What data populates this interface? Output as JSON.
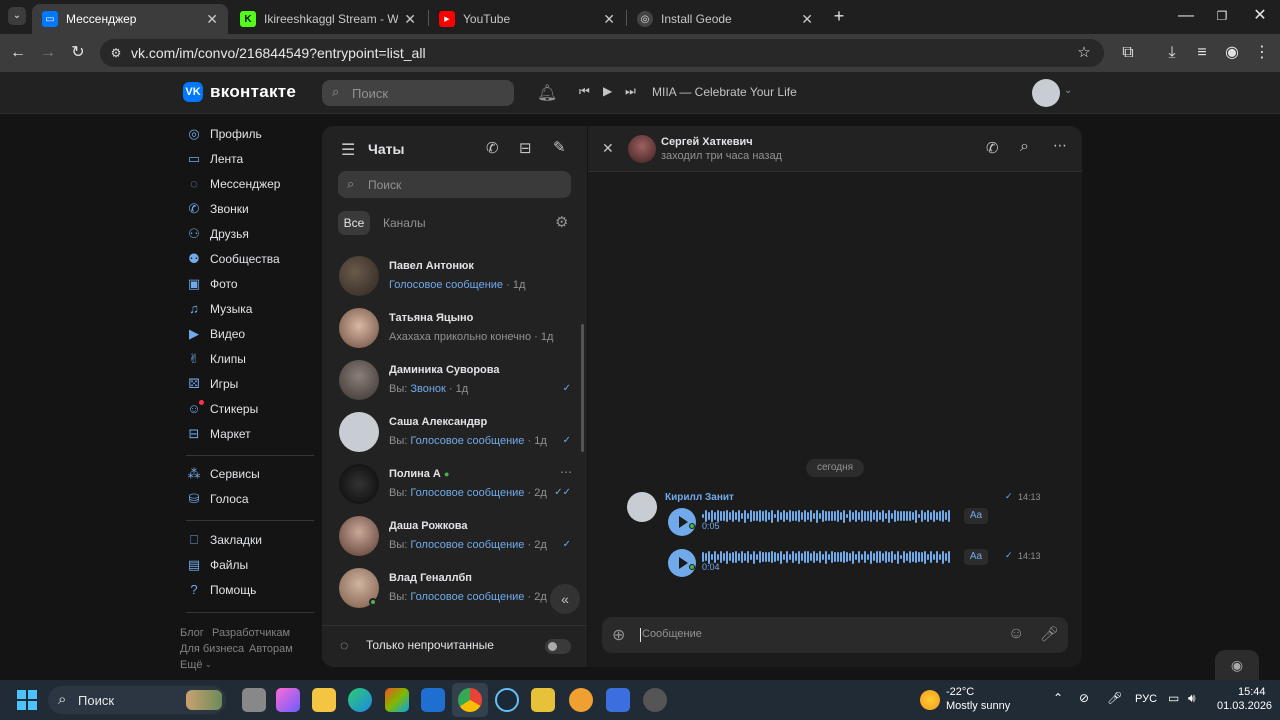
{
  "browser": {
    "tabs": [
      {
        "title": "Мессенджер",
        "active": true
      },
      {
        "title": "Ikireeshkaggl Stream - Watch L",
        "active": false
      },
      {
        "title": "YouTube",
        "active": false
      },
      {
        "title": "Install Geode",
        "active": false
      }
    ],
    "url": "vk.com/im/convo/216844549?entrypoint=list_all"
  },
  "vk": {
    "brand": "вконтакте",
    "search_placeholder": "Поиск",
    "player_track": "MIIA — Celebrate Your Life"
  },
  "nav": {
    "items": [
      {
        "label": "Профиль",
        "icon": "user-circle-icon"
      },
      {
        "label": "Лента",
        "icon": "feed-icon"
      },
      {
        "label": "Мессенджер",
        "icon": "message-icon"
      },
      {
        "label": "Звонки",
        "icon": "phone-icon"
      },
      {
        "label": "Друзья",
        "icon": "friends-icon"
      },
      {
        "label": "Сообщества",
        "icon": "communities-icon"
      },
      {
        "label": "Фото",
        "icon": "photo-icon"
      },
      {
        "label": "Музыка",
        "icon": "music-icon"
      },
      {
        "label": "Видео",
        "icon": "video-icon"
      },
      {
        "label": "Клипы",
        "icon": "clips-icon"
      },
      {
        "label": "Игры",
        "icon": "games-icon"
      },
      {
        "label": "Стикеры",
        "icon": "stickers-icon"
      },
      {
        "label": "Маркет",
        "icon": "market-icon"
      }
    ],
    "items2": [
      {
        "label": "Сервисы",
        "icon": "services-icon"
      },
      {
        "label": "Голоса",
        "icon": "votes-icon"
      }
    ],
    "items3": [
      {
        "label": "Закладки",
        "icon": "bookmark-icon"
      },
      {
        "label": "Файлы",
        "icon": "files-icon"
      },
      {
        "label": "Помощь",
        "icon": "help-icon"
      }
    ],
    "footer": [
      "Блог",
      "Разработчикам",
      "Для бизнеса",
      "Авторам",
      "Ещё"
    ]
  },
  "chats": {
    "title": "Чаты",
    "search_placeholder": "Поиск",
    "tab_all": "Все",
    "tab_channels": "Каналы",
    "unread_only": "Только непрочитанные",
    "list": [
      {
        "name": "Павел Антонюк",
        "prefix": "",
        "preview_link": "Голосовое сообщение",
        "preview_text": "",
        "time": "1д",
        "check": ""
      },
      {
        "name": "Татьяна Яцыно",
        "prefix": "",
        "preview_link": "",
        "preview_text": "Ахахаха прикольно конечно",
        "time": "1д",
        "check": ""
      },
      {
        "name": "Даминика Суворова",
        "prefix": "Вы: ",
        "preview_link": "Звонок",
        "preview_text": "",
        "time": "1д",
        "check": "✓"
      },
      {
        "name": "Саша Александвр",
        "prefix": "Вы: ",
        "preview_link": "Голосовое сообщение",
        "preview_text": "",
        "time": "1д",
        "check": "✓"
      },
      {
        "name": "Полина А",
        "prefix": "Вы: ",
        "preview_link": "Голосовое сообщение",
        "preview_text": "",
        "time": "2д",
        "check": "✓✓"
      },
      {
        "name": "Даша Рожкова",
        "prefix": "Вы: ",
        "preview_link": "Голосовое сообщение",
        "preview_text": "",
        "time": "2д",
        "check": "✓"
      },
      {
        "name": "Влад Геналлбп",
        "prefix": "Вы: ",
        "preview_link": "Голосовое сообщение",
        "preview_text": "",
        "time": "2д",
        "check": ""
      }
    ]
  },
  "conversation": {
    "name": "Сергей Хаткевич",
    "status": "заходил три часа назад",
    "date_divider": "сегодня",
    "sender": "Кирилл Занит",
    "messages": [
      {
        "duration": "0:05",
        "time": "14:13",
        "transcribe": "Aa"
      },
      {
        "duration": "0:04",
        "time": "14:13",
        "transcribe": "Aa"
      }
    ],
    "input_placeholder": "Сообщение"
  },
  "taskbar": {
    "search_placeholder": "Поиск",
    "weather_temp": "-22°C",
    "weather_desc": "Mostly sunny",
    "lang": "РУС",
    "time": "15:44",
    "date": "01.03.2026"
  }
}
